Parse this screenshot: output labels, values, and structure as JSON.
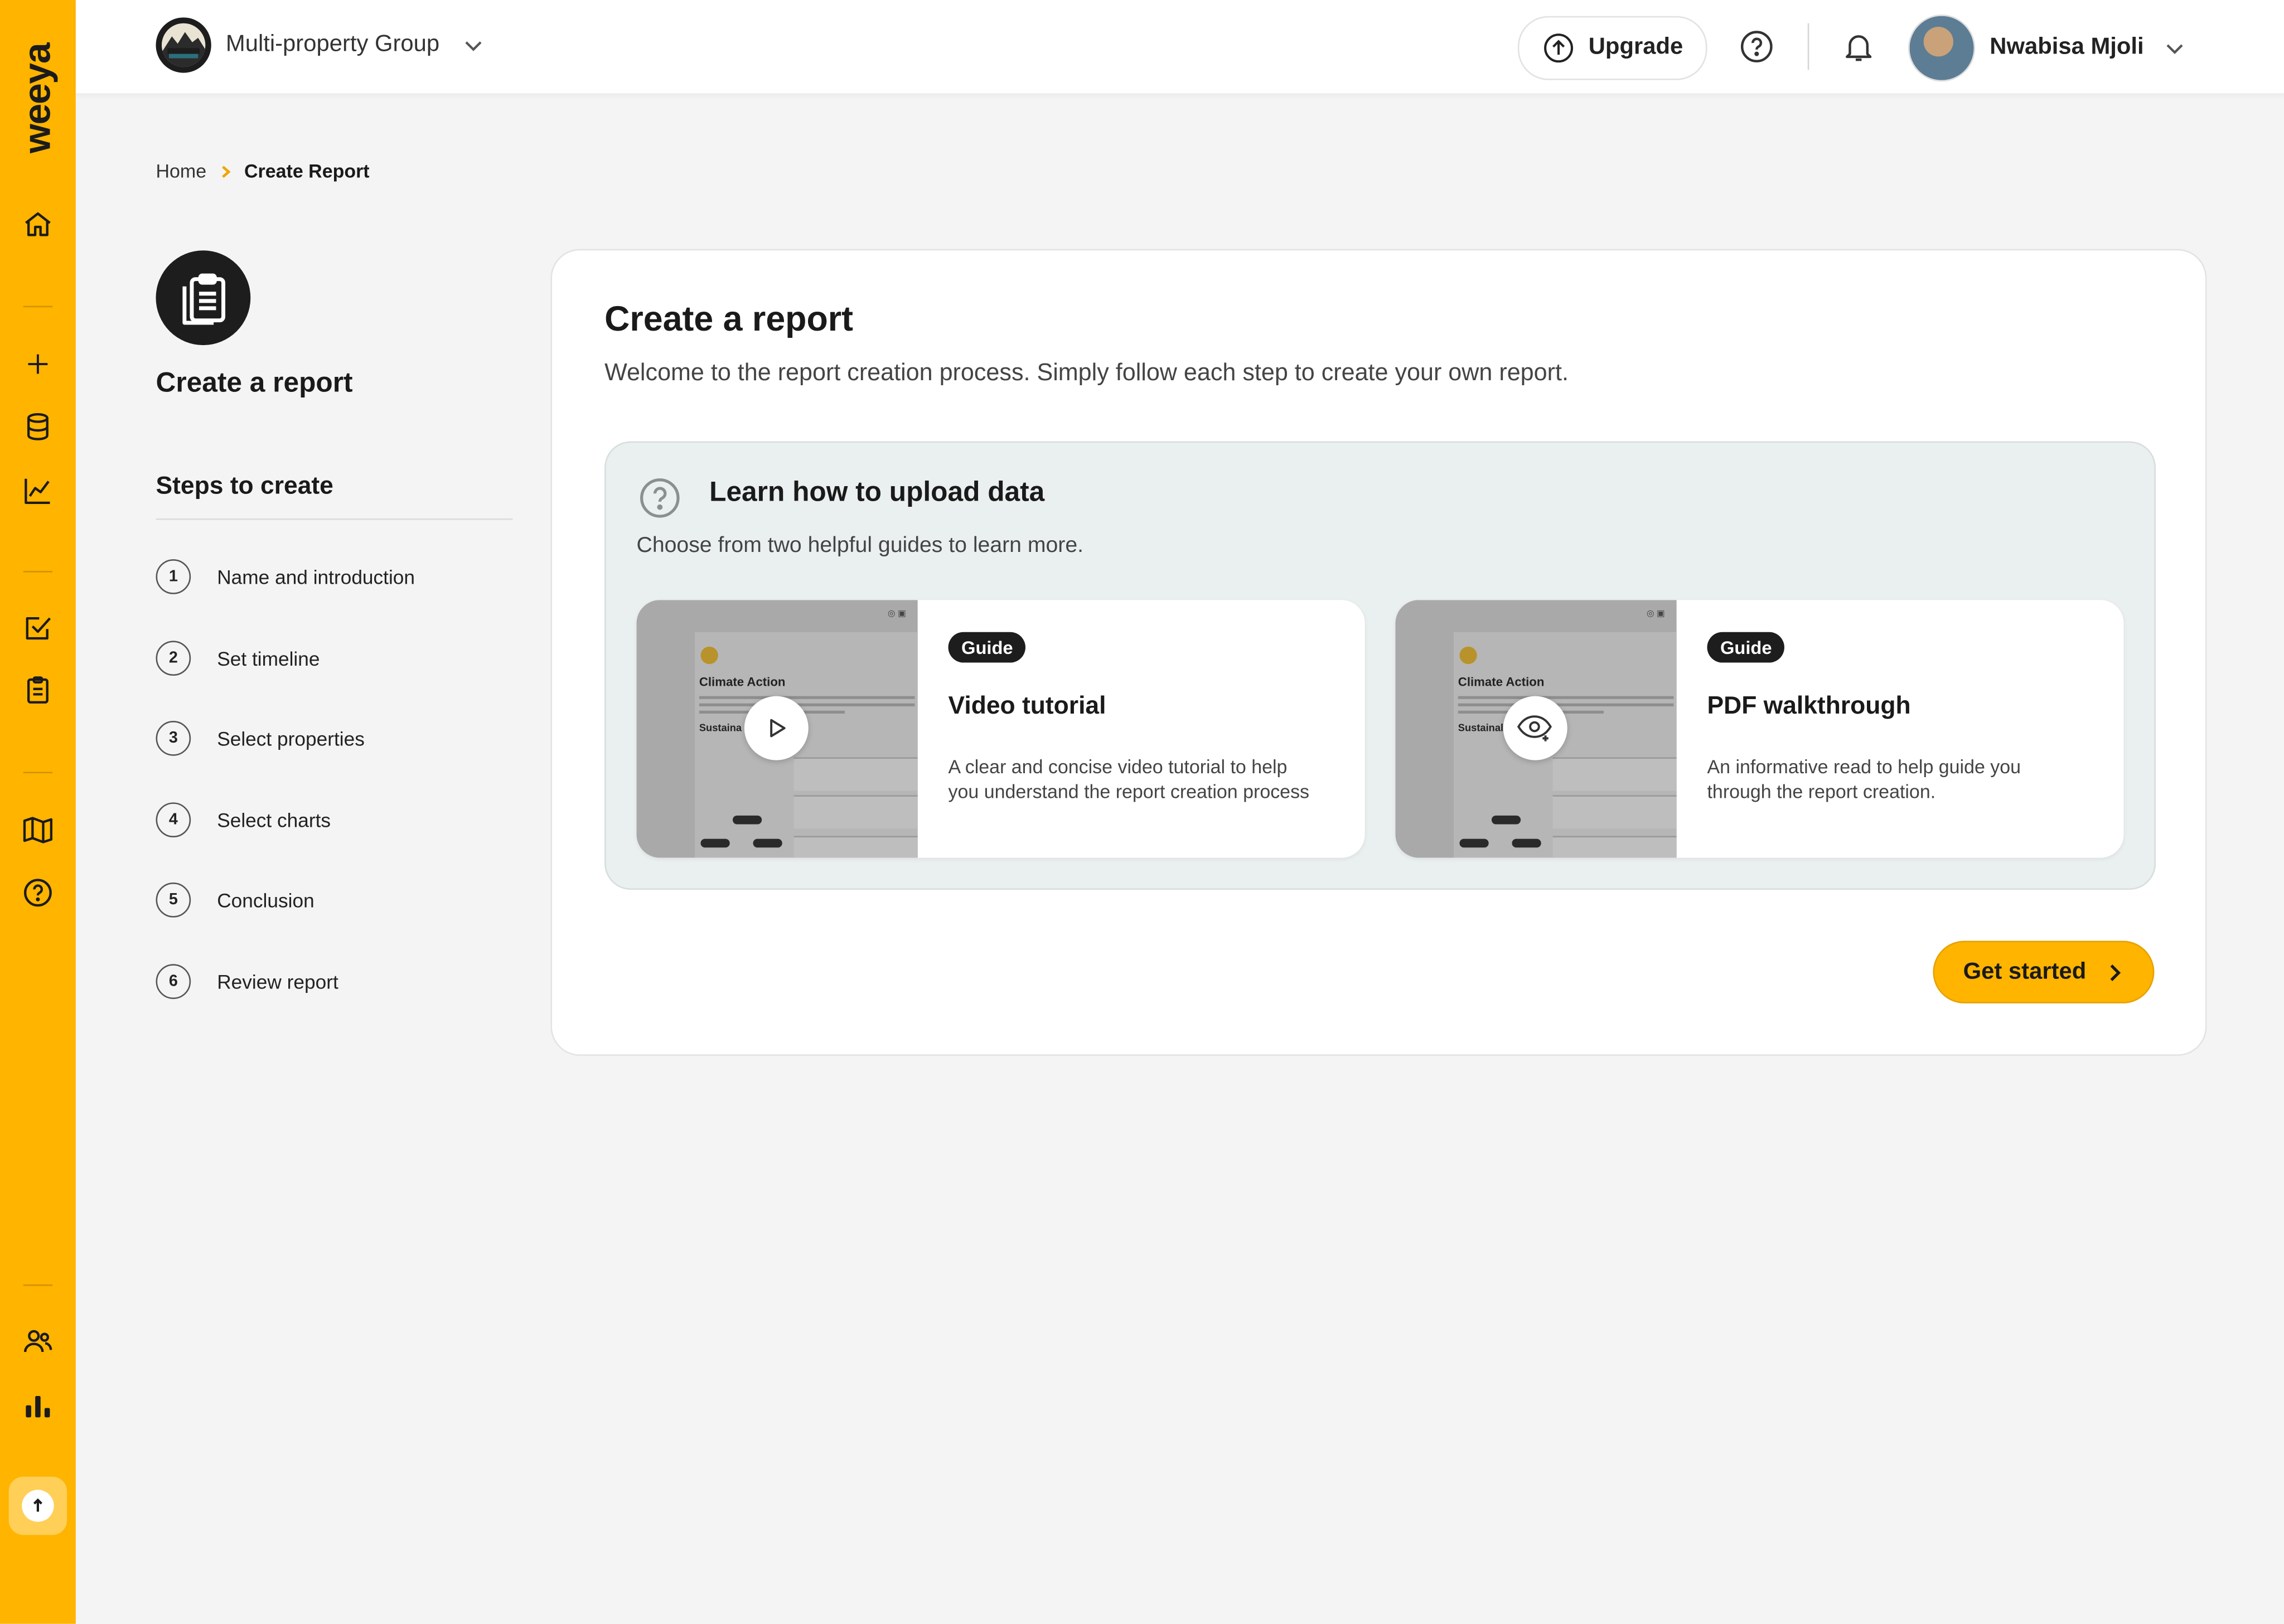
{
  "brand": {
    "logo_text": "weeya",
    "accent_color": "#ffb400"
  },
  "sidebar": {
    "icons": [
      "home-icon",
      "plus-icon",
      "database-icon",
      "chart-line-icon",
      "checklist-icon",
      "clipboard-icon",
      "book-icon",
      "help-icon",
      "users-icon",
      "bar-chart-icon",
      "upload-icon"
    ]
  },
  "topbar": {
    "org_name": "Multi-property Group",
    "upgrade_label": "Upgrade",
    "user_name": "Nwabisa Mjoli"
  },
  "breadcrumb": {
    "home": "Home",
    "current": "Create Report"
  },
  "left_panel": {
    "title": "Create a report",
    "steps_title": "Steps to create",
    "steps": [
      {
        "num": "1",
        "label": "Name and introduction"
      },
      {
        "num": "2",
        "label": "Set timeline"
      },
      {
        "num": "3",
        "label": "Select properties"
      },
      {
        "num": "4",
        "label": "Select charts"
      },
      {
        "num": "5",
        "label": "Conclusion"
      },
      {
        "num": "6",
        "label": "Review report"
      }
    ]
  },
  "main": {
    "title": "Create a report",
    "subtitle": "Welcome to the report creation process. Simply follow each step to create your own report.",
    "learn": {
      "title": "Learn how to upload data",
      "subtitle": "Choose from two helpful guides to learn more."
    },
    "guides": [
      {
        "tag": "Guide",
        "title": "Video tutorial",
        "description": "A clear and concise video tutorial to help you understand the report creation process",
        "thumb_heading": "Climate Action",
        "thumb_sub": "Sustaina",
        "overlay_icon": "play-icon"
      },
      {
        "tag": "Guide",
        "title": "PDF walkthrough",
        "description": "An informative read to help guide you through the report creation.",
        "thumb_heading": "Climate Action",
        "thumb_sub": "Sustainal",
        "overlay_icon": "eye-icon"
      }
    ],
    "cta_label": "Get started"
  }
}
